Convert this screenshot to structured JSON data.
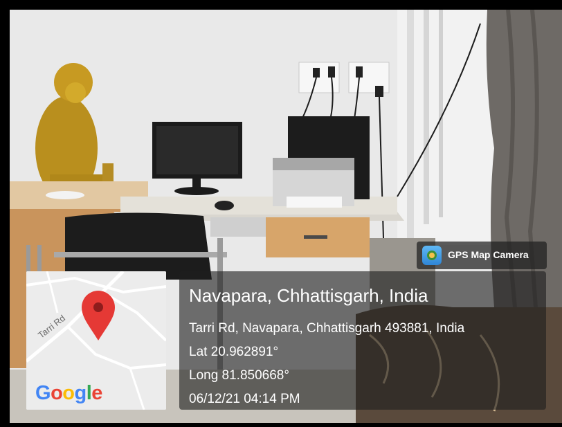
{
  "overlay": {
    "app_badge": "GPS Map Camera",
    "location_title": "Navapara, Chhattisgarh, India",
    "address": "Tarri Rd, Navapara, Chhattisgarh 493881, India",
    "latitude": "Lat 20.962891°",
    "longitude": "Long 81.850668°",
    "datetime": "06/12/21 04:14 PM"
  },
  "map": {
    "road_label": "Tarri Rd",
    "provider": [
      "G",
      "o",
      "o",
      "g",
      "l",
      "e"
    ],
    "provider_colors": [
      "#4285F4",
      "#EA4335",
      "#FBBC05",
      "#4285F4",
      "#34A853",
      "#EA4335"
    ],
    "pin_color": "#E53935",
    "pin_icon": "location-pin-icon"
  },
  "icons": {
    "app_icon": "gps-map-camera-icon"
  }
}
